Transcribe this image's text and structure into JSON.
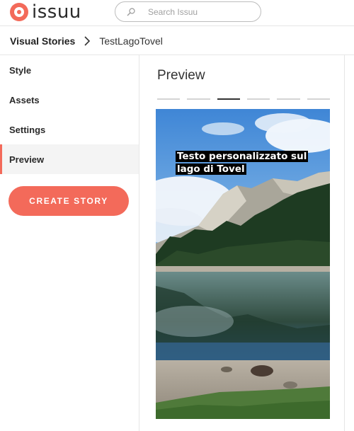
{
  "header": {
    "logo_text": "issuu",
    "search": {
      "placeholder": "Search Issuu",
      "icon": "search-icon"
    }
  },
  "breadcrumb": {
    "root": "Visual Stories",
    "current": "TestLagoTovel"
  },
  "sidebar": {
    "items": [
      {
        "label": "Style",
        "active": false
      },
      {
        "label": "Assets",
        "active": false
      },
      {
        "label": "Settings",
        "active": false
      },
      {
        "label": "Preview",
        "active": true
      }
    ],
    "create_button": "CREATE STORY"
  },
  "main": {
    "title": "Preview",
    "progress": {
      "total": 6,
      "current_index": 2
    },
    "story": {
      "caption": "Testo personalizzato sul lago di Tovel"
    }
  },
  "colors": {
    "accent": "#f36a5a",
    "active_segment": "#333333",
    "inactive_segment": "#d4d4d4"
  }
}
